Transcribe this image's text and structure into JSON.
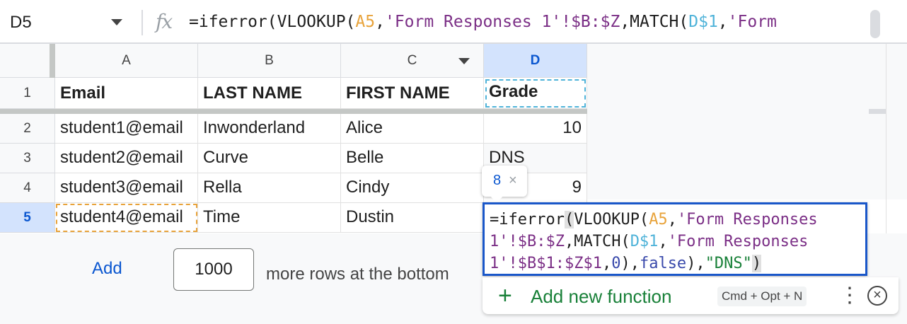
{
  "formula_bar": {
    "name_box": "D5",
    "fx_label": "fx",
    "formula_visible": [
      "=iferror(",
      "VLOOKUP(",
      "A5",
      ",",
      "'Form Responses 1'!$B:$Z",
      ",MATCH(",
      "D$1",
      ",",
      "'Form"
    ]
  },
  "columns": [
    "A",
    "B",
    "C",
    "D"
  ],
  "rows": [
    {
      "num": "1",
      "cells": [
        "Email",
        "LAST NAME",
        "FIRST NAME",
        "Grade"
      ]
    },
    {
      "num": "2",
      "cells": [
        "student1@email",
        "Inwonderland",
        "Alice",
        "10"
      ]
    },
    {
      "num": "3",
      "cells": [
        "student2@email",
        "Curve",
        "Belle",
        "DNS"
      ]
    },
    {
      "num": "4",
      "cells": [
        "student3@email",
        "Rella",
        "Cindy",
        "9"
      ]
    },
    {
      "num": "5",
      "cells": [
        "student4@email",
        "Time",
        "Dustin",
        ""
      ]
    }
  ],
  "add_rows": {
    "button": "Add",
    "count": "1000",
    "suffix": "more rows at the bottom"
  },
  "arg_tooltip": {
    "value": "8",
    "close": "×"
  },
  "editor": {
    "line1": [
      "=iferror",
      "(",
      "VLOOKUP(",
      "A5",
      ",",
      "'Form Responses"
    ],
    "line2": [
      "1'!$B:$Z",
      ",MATCH(",
      "D$1",
      ",",
      "'Form Responses"
    ],
    "line3": [
      "1'!$B$1:$Z$1",
      ",",
      "0",
      "),",
      "false",
      "),",
      "\"DNS\"",
      ")"
    ]
  },
  "function_bar": {
    "add_label": "Add new function",
    "shortcut": "Cmd + Opt + N"
  },
  "colors": {
    "selection": "#1a57c9",
    "header_selected": "#d3e3fd",
    "green": "#188038"
  }
}
